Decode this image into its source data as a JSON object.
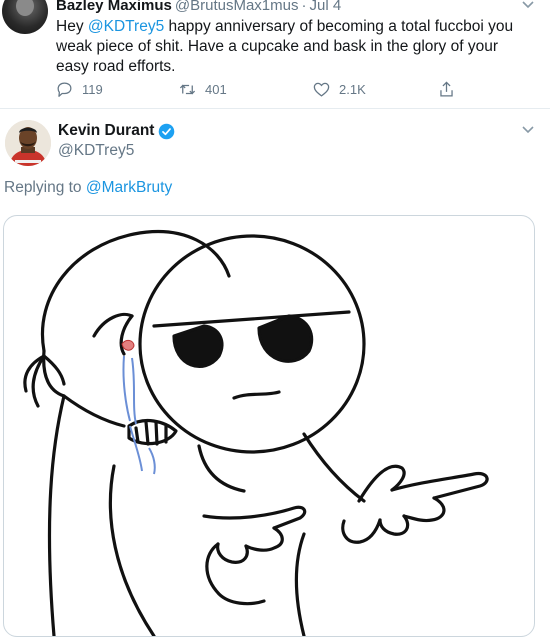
{
  "tweet1": {
    "display_name": "Bazley Maximus",
    "handle": "@BrutusMax1mus",
    "separator": "·",
    "date": "Jul 4",
    "text_start": "Hey ",
    "mention": "@KDTrey5",
    "text_rest": " happy anniversary of becoming a total fuccboi you weak piece of shit. Have a cupcake and bask in the glory of your easy road efforts.",
    "reply_count": "119",
    "retweet_count": "401",
    "like_count": "2.1K"
  },
  "tweet2": {
    "display_name": "Kevin Durant",
    "handle": "@KDTrey5",
    "replying_prefix": "Replying to ",
    "replying_to": "@MarkBruty"
  },
  "colors": {
    "link": "#1b95e0",
    "secondary_text": "#657786",
    "verified": "#1da1f2",
    "divider": "#e6ecf0"
  },
  "icons": [
    "reply-icon",
    "retweet-icon",
    "like-icon",
    "share-icon",
    "chevron-down-icon",
    "verified-badge-icon"
  ]
}
